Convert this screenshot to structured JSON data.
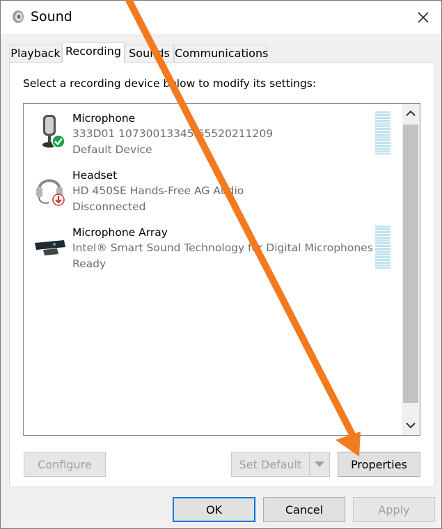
{
  "window": {
    "title": "Sound",
    "title_icon": "speaker-icon",
    "close_icon": "close-icon"
  },
  "tabs": [
    {
      "label": "Playback",
      "active": false
    },
    {
      "label": "Recording",
      "active": true
    },
    {
      "label": "Sounds",
      "active": false
    },
    {
      "label": "Communications",
      "active": false
    }
  ],
  "instructions": "Select a recording device below to modify its settings:",
  "devices": [
    {
      "name": "Microphone",
      "description": "333D01 10730013345 65520211209",
      "status": "Default Device",
      "icon": "microphone-icon",
      "badge": "default-check-icon",
      "level_meter": true
    },
    {
      "name": "Headset",
      "description": "HD 450SE Hands-Free AG Audio",
      "status": "Disconnected",
      "icon": "headset-icon",
      "badge": "disconnected-icon",
      "level_meter": false
    },
    {
      "name": "Microphone Array",
      "description": "Intel® Smart Sound Technology for Digital Microphones",
      "status": "Ready",
      "icon": "microphone-array-icon",
      "badge": "",
      "level_meter": true
    }
  ],
  "buttons": {
    "configure": "Configure",
    "set_default": "Set Default",
    "properties": "Properties",
    "ok": "OK",
    "cancel": "Cancel",
    "apply": "Apply"
  },
  "colors": {
    "accent": "#0078d7",
    "annotation_arrow": "#f47a20",
    "level_meter": "#bfe3ef",
    "check_badge": "#16a34a",
    "disconnect_badge": "#d32f2f"
  }
}
